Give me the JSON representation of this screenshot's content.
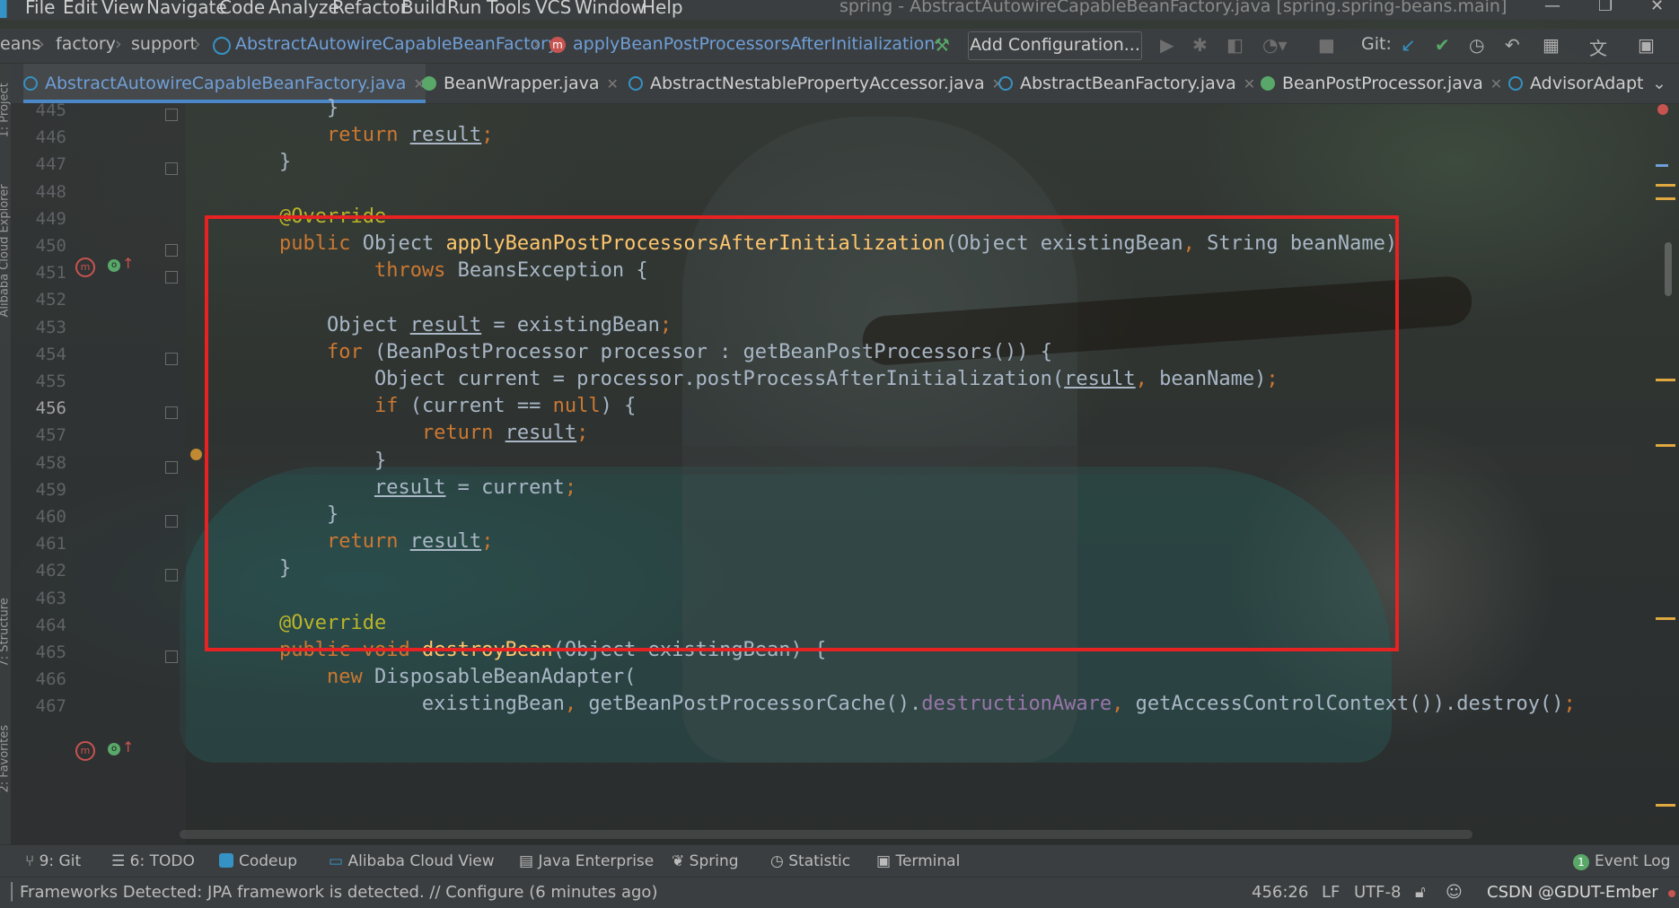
{
  "menu": {
    "items": [
      "File",
      "Edit",
      "View",
      "Navigate",
      "Code",
      "Analyze",
      "Refactor",
      "Build",
      "Run",
      "Tools",
      "VCS",
      "Window",
      "Help"
    ],
    "window_title": "spring - AbstractAutowireCapableBeanFactory.java [spring.spring-beans.main]"
  },
  "breadcrumb": {
    "items": [
      "eans",
      "factory",
      "support",
      "AbstractAutowireCapableBeanFactory",
      "applyBeanPostProcessorsAfterInitialization"
    ]
  },
  "toolbar": {
    "add_configuration": "Add Configuration...",
    "git_label": "Git:"
  },
  "tabs": [
    {
      "label": "AbstractAutowireCapableBeanFactory.java",
      "kind": "class",
      "active": true
    },
    {
      "label": "BeanWrapper.java",
      "kind": "interface",
      "active": false
    },
    {
      "label": "AbstractNestablePropertyAccessor.java",
      "kind": "class",
      "active": false
    },
    {
      "label": "AbstractBeanFactory.java",
      "kind": "class",
      "active": false
    },
    {
      "label": "BeanPostProcessor.java",
      "kind": "interface",
      "active": false
    },
    {
      "label": "AdvisorAdapt",
      "kind": "class",
      "active": false
    }
  ],
  "left_strip": [
    "1: Project",
    "Alibaba Cloud Explorer",
    "7: Structure",
    "2: Favorites"
  ],
  "editor": {
    "line_numbers": [
      "445",
      "446",
      "447",
      "448",
      "449",
      "450",
      "451",
      "452",
      "453",
      "454",
      "455",
      "456",
      "457",
      "458",
      "459",
      "460",
      "461",
      "462",
      "463",
      "464",
      "465",
      "466",
      "467"
    ],
    "current_line": "456",
    "lines": [
      "        }",
      "        return result;",
      "    }",
      "",
      "    @Override",
      "    public Object applyBeanPostProcessorsAfterInitialization(Object existingBean, String beanName)",
      "            throws BeansException {",
      "",
      "        Object result = existingBean;",
      "        for (BeanPostProcessor processor : getBeanPostProcessors()) {",
      "            Object current = processor.postProcessAfterInitialization(result, beanName);",
      "            if (current == null) {",
      "                return result;",
      "            }",
      "            result = current;",
      "        }",
      "        return result;",
      "    }",
      "",
      "    @Override",
      "    public void destroyBean(Object existingBean) {",
      "        new DisposableBeanAdapter(",
      "                existingBean, getBeanPostProcessorCache().destructionAware, getAccessControlContext()).destroy();"
    ]
  },
  "tool_windows": [
    "9: Git",
    "6: TODO",
    "Codeup",
    "Alibaba Cloud View",
    "Java Enterprise",
    "Spring",
    "Statistic",
    "Terminal"
  ],
  "event_log": {
    "count": "1",
    "label": "Event Log"
  },
  "status": {
    "message": "Frameworks Detected: JPA framework is detected. // Configure (6 minutes ago)",
    "position": "456:26",
    "line_sep": "LF",
    "encoding": "UTF-8",
    "watermark": "CSDN @GDUT-Ember"
  },
  "colors": {
    "highlight_box": "#e62222",
    "keyword": "#cc7832",
    "method": "#ffc66d",
    "annotation": "#bbb529",
    "field": "#9876aa"
  }
}
